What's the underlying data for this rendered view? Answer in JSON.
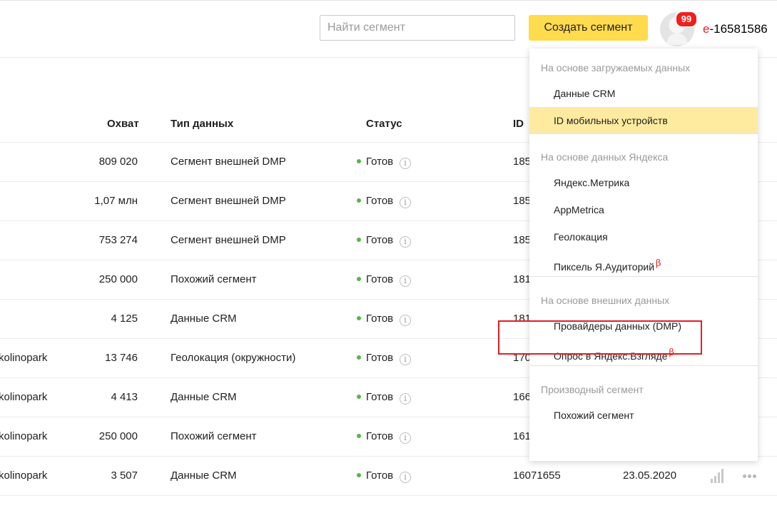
{
  "header": {
    "search_placeholder": "Найти сегмент",
    "create_button": "Создать сегмент",
    "notification_count": "99",
    "login_first": "е",
    "login_rest": "-16581586"
  },
  "table": {
    "columns": {
      "reach": "Охват",
      "type": "Тип данных",
      "status": "Статус",
      "id": "ID"
    },
    "rows": [
      {
        "name": "",
        "reach": "809 020",
        "type": "Сегмент внешней DMP",
        "status": "Готов",
        "id": "185",
        "date": ""
      },
      {
        "name": "",
        "reach": "1,07 млн",
        "type": "Сегмент внешней DMP",
        "status": "Готов",
        "id": "185",
        "date": ""
      },
      {
        "name": "",
        "reach": "753 274",
        "type": "Сегмент внешней DMP",
        "status": "Готов",
        "id": "185",
        "date": ""
      },
      {
        "name": "",
        "reach": "250 000",
        "type": "Похожий сегмент",
        "status": "Готов",
        "id": "181",
        "date": ""
      },
      {
        "name": "",
        "reach": "4 125",
        "type": "Данные CRM",
        "status": "Готов",
        "id": "181",
        "date": ""
      },
      {
        "name": "kolinopark",
        "reach": "13 746",
        "type": "Геолокация (окружности)",
        "status": "Готов",
        "id": "170",
        "date": ""
      },
      {
        "name": "kolinopark",
        "reach": "4 413",
        "type": "Данные CRM",
        "status": "Готов",
        "id": "166",
        "date": ""
      },
      {
        "name": "kolinopark",
        "reach": "250 000",
        "type": "Похожий сегмент",
        "status": "Готов",
        "id": "161",
        "date": ""
      },
      {
        "name": "kolinopark",
        "reach": "3 507",
        "type": "Данные CRM",
        "status": "Готов",
        "id": "16071655",
        "date": "23.05.2020"
      }
    ],
    "info_glyph": "i"
  },
  "dropdown": {
    "groups": [
      {
        "title": "На основе загружаемых данных",
        "items": [
          {
            "label": "Данные CRM"
          },
          {
            "label": "ID мобильных устройств"
          }
        ]
      },
      {
        "title": "На основе данных Яндекса",
        "items": [
          {
            "label": "Яндекс.Метрика"
          },
          {
            "label": "AppMetrica"
          },
          {
            "label": "Геолокация"
          },
          {
            "label": "Пиксель Я.Аудиторий"
          }
        ]
      },
      {
        "title": "На основе внешних данных",
        "items": [
          {
            "label": "Провайдеры данных (DMP)"
          },
          {
            "label": "Опрос в Яндекс.Взгляде"
          }
        ]
      },
      {
        "title": "Производный сегмент",
        "items": [
          {
            "label": "Похожий сегмент"
          }
        ]
      }
    ],
    "beta_mark": "β"
  },
  "colors": {
    "accent_yellow": "#ffdb4d",
    "highlight": "#ffeba0",
    "badge_red": "#f0201c",
    "status_green": "#55b648",
    "callout_red": "#e31e24"
  }
}
